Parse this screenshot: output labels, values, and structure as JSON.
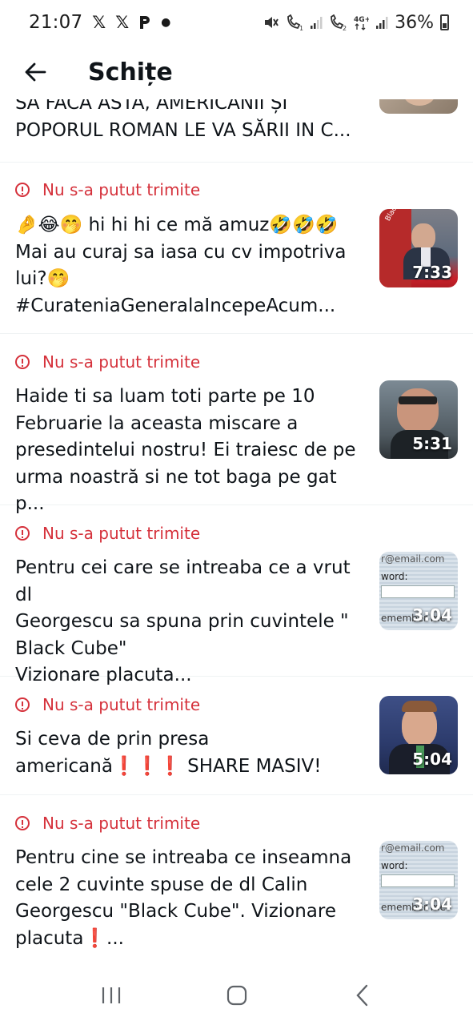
{
  "status_bar": {
    "time": "21:07",
    "icons_left": [
      "x-icon",
      "x-icon",
      "parler-icon",
      "dot"
    ],
    "battery_percent": "36%"
  },
  "header": {
    "title": "Schițe"
  },
  "colors": {
    "error_red": "#d5313b",
    "text": "#0f1419",
    "divider": "#eff3f4"
  },
  "drafts": [
    {
      "text": "SĂ FACĂ ASTA, AMERICANII ȘI\nPOPORUL ROMAN LE VA SĂRII IN C..."
    },
    {
      "error": "Nu s-a putut trimite",
      "text": "🤌😂🤭 hi hi hi ce mă amuz🤣🤣🤣\nMai au curaj sa iasa cu cv impotriva\nlui?🤭\n#CurateniaGeneralaIncepeAcum...",
      "duration": "7:33",
      "thumb_caption": "Black Cube"
    },
    {
      "error": "Nu s-a putut trimite",
      "text": "Haide ti sa luam toti parte pe 10\nFebruarie la aceasta miscare a\npresedintelui nostru! Ei traiesc de pe\nurma noastră si ne tot baga pe gat p...",
      "duration": "5:31"
    },
    {
      "error": "Nu s-a putut trimite",
      "text": "Pentru cei care se intreaba ce a vrut dl\nGeorgescu sa spuna prin cuvintele \"\nBlack Cube\"\nVizionare placuta...",
      "duration": "3:04",
      "thumb_lines": [
        "r@email.com",
        "word:",
        "emember me"
      ]
    },
    {
      "error": "Nu s-a putut trimite",
      "text": "Si ceva de prin presa\namericană❗❗❗ SHARE MASIV!",
      "duration": "5:04"
    },
    {
      "error": "Nu s-a putut trimite",
      "text": "Pentru cine se intreaba ce inseamna\ncele 2 cuvinte spuse de dl Calin\nGeorgescu \"Black Cube\". Vizionare\nplacuta❗...",
      "duration": "3:04",
      "thumb_lines": [
        "r@email.com",
        "word:",
        "emember me"
      ]
    }
  ]
}
